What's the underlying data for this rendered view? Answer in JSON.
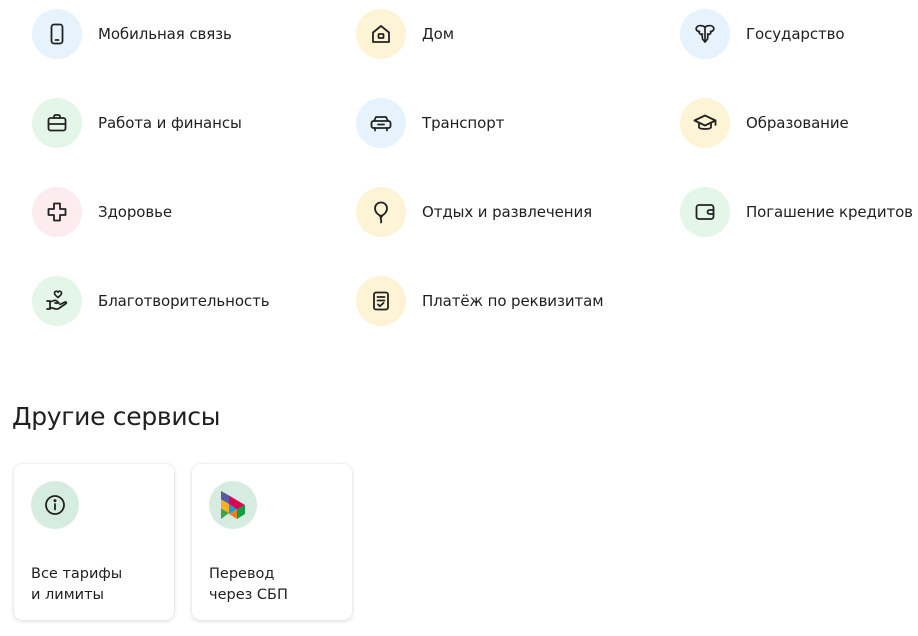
{
  "categories": [
    {
      "label": "Мобильная связь",
      "icon": "phone-icon",
      "bg": "#e6f3fc"
    },
    {
      "label": "Дом",
      "icon": "house-icon",
      "bg": "#fdf3d5"
    },
    {
      "label": "Государство",
      "icon": "government-emblem-icon",
      "bg": "#e6f3fc"
    },
    {
      "label": "Работа и финансы",
      "icon": "briefcase-icon",
      "bg": "#e3f6e8"
    },
    {
      "label": "Транспорт",
      "icon": "car-icon",
      "bg": "#e6f3fc"
    },
    {
      "label": "Образование",
      "icon": "graduation-cap-icon",
      "bg": "#fdf3d5"
    },
    {
      "label": "Здоровье",
      "icon": "medical-cross-icon",
      "bg": "#fcecef"
    },
    {
      "label": "Отдых и развлечения",
      "icon": "balloon-icon",
      "bg": "#fdf3d5"
    },
    {
      "label": "Погашение кредитов",
      "icon": "wallet-icon",
      "bg": "#e3f6e8"
    },
    {
      "label": "Благотворительность",
      "icon": "heart-hand-icon",
      "bg": "#e3f6e8"
    },
    {
      "label": "Платёж по реквизитам",
      "icon": "document-check-icon",
      "bg": "#fdf3d5"
    }
  ],
  "other_services": {
    "title": "Другие сервисы",
    "cards": [
      {
        "line1": "Все тарифы",
        "line2": "и лимиты",
        "icon": "info-icon"
      },
      {
        "line1": "Перевод",
        "line2": "через СБП",
        "icon": "sbp-logo-icon"
      }
    ]
  },
  "colors": {
    "text": "#1f1f1f",
    "icon_stroke": "#222222",
    "card_icon_bg": "#d7ece0"
  }
}
